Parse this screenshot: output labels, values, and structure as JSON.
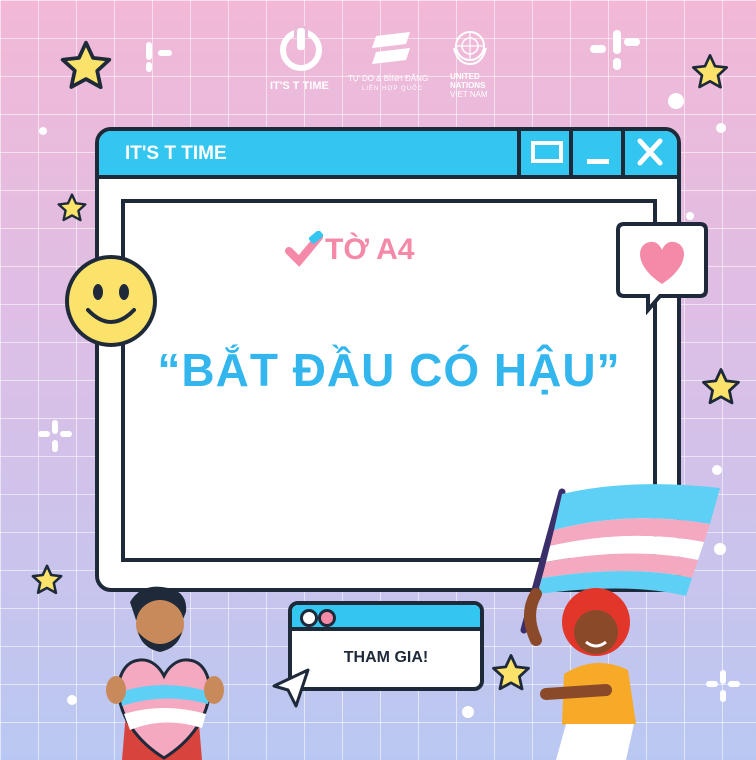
{
  "header_logos": {
    "brand_left": "IT'S T TIME",
    "brand_mid": "TỰ DO & BÌNH ĐẲNG",
    "brand_mid_sub": "LIÊN HỢP QUỐC",
    "un_line1": "UNITED",
    "un_line2": "NATIONS",
    "un_line3": "VIET NAM"
  },
  "window": {
    "title": "IT'S T TIME",
    "brand": "TỜ A4",
    "headline": "“BẮT ĐẦU CÓ HẬU”"
  },
  "dialog": {
    "label": "THAM GIA!"
  },
  "colors": {
    "accent": "#33c6f0",
    "outline": "#1e2a3a",
    "pink": "#f48aa8",
    "star": "#fbe36b"
  }
}
